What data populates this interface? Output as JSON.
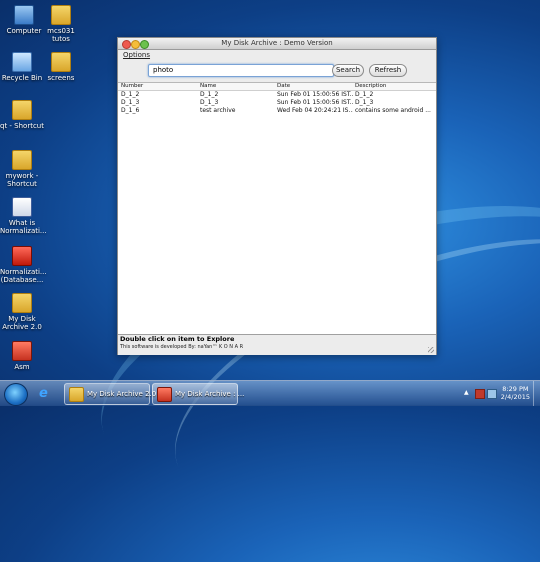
{
  "desktop": {
    "icons": [
      {
        "label": "Computer",
        "icon": "computer-icon"
      },
      {
        "label": "mcs031 tutos",
        "icon": "folder-icon"
      },
      {
        "label": "Recycle Bin",
        "icon": "recycle-bin-icon"
      },
      {
        "label": "screens",
        "icon": "folder-icon"
      },
      {
        "label": "qt - Shortcut",
        "icon": "shortcut-icon"
      },
      {
        "label": "mywork - Shortcut",
        "icon": "shortcut-icon"
      },
      {
        "label": "What is Normalizati...",
        "icon": "word-document-icon"
      },
      {
        "label": "Normalizati... (Database...",
        "icon": "pdf-icon"
      },
      {
        "label": "My Disk Archive 2.0",
        "icon": "folder-icon"
      },
      {
        "label": "Asm",
        "icon": "app-icon"
      }
    ]
  },
  "window": {
    "title": "My Disk Archive : Demo Version",
    "menu": {
      "options": "Options"
    },
    "search": {
      "value": "photo",
      "search_label": "Search",
      "refresh_label": "Refresh"
    },
    "table": {
      "columns": [
        "Number",
        "Name",
        "Date",
        "Description"
      ],
      "rows": [
        [
          "D_1_2",
          "D_1_2",
          "Sun Feb 01 15:00:56 IST...",
          "D_1_2"
        ],
        [
          "D_1_3",
          "D_1_3",
          "Sun Feb 01 15:00:56 IST...",
          "D_1_3"
        ],
        [
          "D_1_6",
          "test archive",
          "Wed Feb 04 20:24:21 IS...",
          "contains some android ..."
        ]
      ]
    },
    "footer": {
      "hint": "Double click on item to Explore",
      "developer": "This software is developed By: naYan™ K O N A R"
    }
  },
  "taskbar": {
    "items": [
      {
        "label": "My Disk Archive 2.0",
        "icon": "folder-icon"
      },
      {
        "label": "My Disk Archive : ...",
        "icon": "java-app-icon"
      }
    ],
    "clock": {
      "time": "8:29 PM",
      "date": "2/4/2015"
    }
  }
}
